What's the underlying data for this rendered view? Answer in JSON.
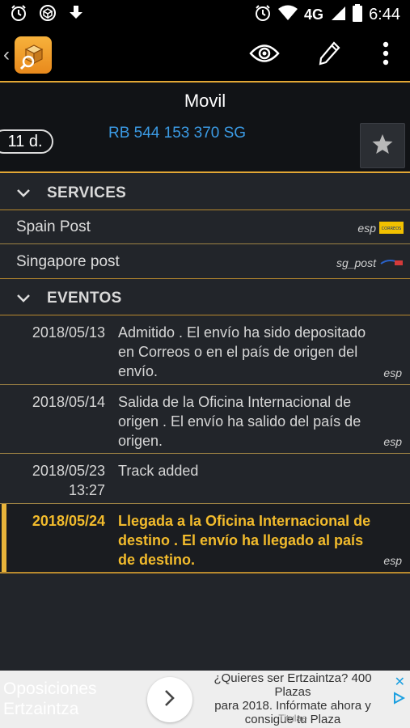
{
  "status_bar": {
    "network": "4G",
    "time": "6:44"
  },
  "shipment": {
    "name": "Movil",
    "age": "11 d.",
    "tracking_number": "RB 544 153 370 SG"
  },
  "services": {
    "title": "SERVICES",
    "items": [
      {
        "name": "Spain Post",
        "code": "esp",
        "logo": "correos-logo",
        "logo_text": "CORREOS"
      },
      {
        "name": "Singapore post",
        "code": "sg_post",
        "logo": "singpost-logo"
      }
    ]
  },
  "events": {
    "title": "EVENTOS",
    "items": [
      {
        "date": "2018/05/13",
        "time": "",
        "text": "Admitido . El envío ha sido depositado en Correos o en el país de origen del envío.",
        "source": "esp",
        "highlight": false
      },
      {
        "date": "2018/05/14",
        "time": "",
        "text": "Salida de la Oficina Internacional de origen . El envío ha salido del país de origen.",
        "source": "esp",
        "highlight": false
      },
      {
        "date": "2018/05/23",
        "time": "13:27",
        "text": "Track added",
        "source": "",
        "highlight": false
      },
      {
        "date": "2018/05/24",
        "time": "",
        "text": "Llegada a la Oficina Internacional de destino . El envío ha llegado al país de destino.",
        "source": "esp",
        "highlight": true
      }
    ]
  },
  "ad": {
    "left_line1": "Oposiciones",
    "left_line2": "Ertzaintza",
    "text_line1": "¿Quieres ser Ertzaintza? 400 Plazas",
    "text_line2": "para 2018. Infórmate ahora y",
    "text_line3": "consigue tu Plaza",
    "sponsor": "Titulae"
  },
  "colors": {
    "accent": "#e2a735",
    "highlight_text": "#f2bb2c",
    "link": "#3b9be5",
    "background": "#22252a"
  }
}
